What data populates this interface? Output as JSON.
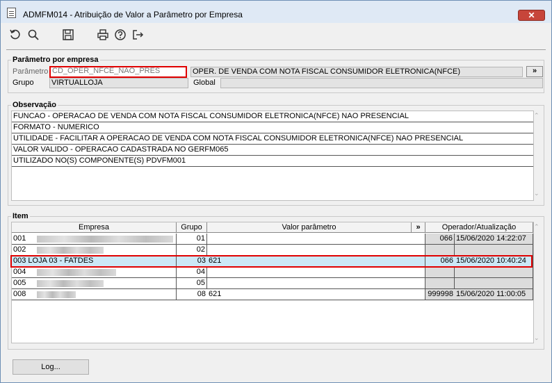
{
  "window": {
    "title": "ADMFM014 - Atribuição de Valor a Parâmetro por Empresa",
    "close_label": "✕"
  },
  "toolbar": {
    "icons": [
      "undo-icon",
      "search-icon",
      "save-icon",
      "print-icon",
      "help-icon",
      "exit-icon"
    ]
  },
  "parametro_empresa": {
    "legend": "Parâmetro por empresa",
    "parametro_label": "Parâmetro",
    "parametro_value": "CD_OPER_NFCE_NAO_PRES",
    "descricao_value": "OPER. DE VENDA COM NOTA FISCAL CONSUMIDOR ELETRONICA(NFCE)",
    "expand_label": "»",
    "grupo_label": "Grupo",
    "grupo_value": "VIRTUALLOJA",
    "global_label": "Global",
    "global_value": ""
  },
  "observacao": {
    "legend": "Observação",
    "lines": [
      "FUNCAO - OPERACAO DE VENDA COM NOTA FISCAL CONSUMIDOR ELETRONICA(NFCE) NAO PRESENCIAL",
      "FORMATO - NUMERICO",
      "UTILIDADE - FACILITAR A OPERACAO DE VENDA COM NOTA FISCAL CONSUMIDOR ELETRONICA(NFCE) NAO PRESENCIAL",
      "VALOR VALIDO - OPERACAO CADASTRADA NO GERFM065",
      "UTILIZADO NO(S) COMPONENTE(S) PDVFM001"
    ]
  },
  "item": {
    "legend": "Item",
    "columns": {
      "empresa": "Empresa",
      "grupo": "Grupo",
      "valor": "Valor parâmetro",
      "expand": "»",
      "operador": "Operador/Atualização"
    },
    "rows": [
      {
        "code": "001",
        "empresa": "",
        "grupo": "01",
        "valor": "",
        "operador": "066",
        "data": "15/06/2020 14:22:07"
      },
      {
        "code": "002",
        "empresa": "",
        "grupo": "02",
        "valor": "",
        "operador": "",
        "data": ""
      },
      {
        "code": "003",
        "empresa": "LOJA 03 - FATDES",
        "grupo": "03",
        "valor": "621",
        "operador": "066",
        "data": "15/06/2020 10:40:24"
      },
      {
        "code": "004",
        "empresa": "",
        "grupo": "04",
        "valor": "",
        "operador": "",
        "data": ""
      },
      {
        "code": "005",
        "empresa": "",
        "grupo": "05",
        "valor": "",
        "operador": "",
        "data": ""
      },
      {
        "code": "008",
        "empresa": "",
        "grupo": "08",
        "valor": "621",
        "operador": "999998",
        "data": "15/06/2020 11:00:05"
      }
    ]
  },
  "footer": {
    "log_label": "Log..."
  }
}
